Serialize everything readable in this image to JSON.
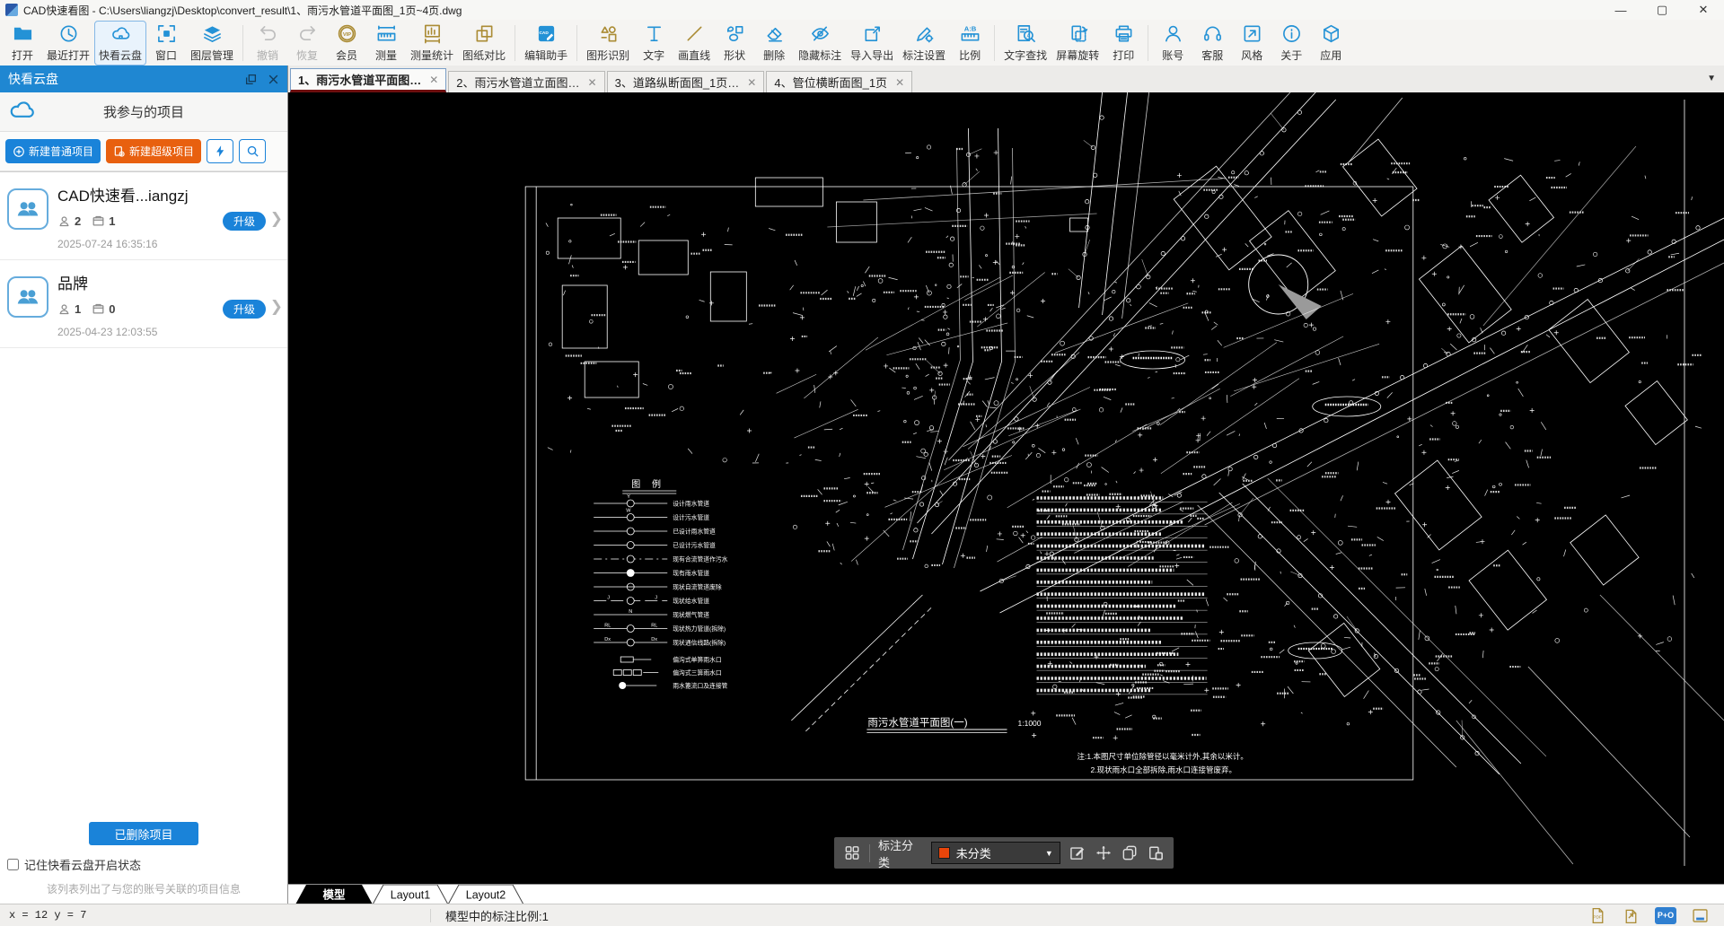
{
  "window": {
    "title": "CAD快速看图 - C:\\Users\\liangzj\\Desktop\\convert_result\\1、雨污水管道平面图_1页~4页.dwg",
    "minimize": "—",
    "maximize": "▢",
    "close": "✕"
  },
  "toolbar": {
    "items": [
      {
        "label": "打开",
        "icon": "open-folder",
        "color": "blue"
      },
      {
        "label": "最近打开",
        "icon": "recent-clock",
        "color": "blue"
      },
      {
        "label": "快看云盘",
        "icon": "cloud",
        "color": "blue",
        "state": "active"
      },
      {
        "label": "窗口",
        "icon": "window",
        "color": "blue"
      },
      {
        "label": "图层管理",
        "icon": "layers",
        "color": "blue",
        "divider_after": true
      },
      {
        "label": "撤销",
        "icon": "undo",
        "color": "gray",
        "state": "disabled"
      },
      {
        "label": "恢复",
        "icon": "redo",
        "color": "gray",
        "state": "disabled"
      },
      {
        "label": "会员",
        "icon": "vip",
        "color": "gold"
      },
      {
        "label": "测量",
        "icon": "measure",
        "color": "blue"
      },
      {
        "label": "测量统计",
        "icon": "measure-stats",
        "color": "gold"
      },
      {
        "label": "图纸对比",
        "icon": "compare",
        "color": "gold",
        "divider_after": true
      },
      {
        "label": "编辑助手",
        "icon": "edit-assistant",
        "color": "blue",
        "divider_after": true
      },
      {
        "label": "图形识别",
        "icon": "shape-recognition",
        "color": "gold"
      },
      {
        "label": "文字",
        "icon": "text",
        "color": "blue"
      },
      {
        "label": "画直线",
        "icon": "draw-line",
        "color": "gold"
      },
      {
        "label": "形状",
        "icon": "shapes",
        "color": "blue"
      },
      {
        "label": "删除",
        "icon": "eraser",
        "color": "blue"
      },
      {
        "label": "隐藏标注",
        "icon": "hide-annotation",
        "color": "blue"
      },
      {
        "label": "导入导出",
        "icon": "import-export",
        "color": "blue"
      },
      {
        "label": "标注设置",
        "icon": "annotation-settings",
        "color": "blue"
      },
      {
        "label": "比例",
        "icon": "scale-ratio",
        "color": "blue",
        "divider_after": true
      },
      {
        "label": "文字查找",
        "icon": "text-search",
        "color": "blue"
      },
      {
        "label": "屏幕旋转",
        "icon": "screen-rotate",
        "color": "blue"
      },
      {
        "label": "打印",
        "icon": "print",
        "color": "blue",
        "divider_after": true
      },
      {
        "label": "账号",
        "icon": "account",
        "color": "blue"
      },
      {
        "label": "客服",
        "icon": "support",
        "color": "blue"
      },
      {
        "label": "风格",
        "icon": "style",
        "color": "blue"
      },
      {
        "label": "关于",
        "icon": "about",
        "color": "blue"
      },
      {
        "label": "应用",
        "icon": "apps",
        "color": "blue"
      }
    ]
  },
  "sidebar": {
    "header": "快看云盘",
    "panel_title": "我参与的项目",
    "actions": {
      "new_normal": "新建普通项目",
      "new_super": "新建超级项目"
    },
    "projects": [
      {
        "name": "CAD快速看...iangzj",
        "members": "2",
        "files": "1",
        "upgrade": "升级",
        "date": "2025-07-24 16:35:16"
      },
      {
        "name": "品牌",
        "members": "1",
        "files": "0",
        "upgrade": "升级",
        "date": "2025-04-23 12:03:55"
      }
    ],
    "deleted_button": "已删除项目",
    "remember_checkbox": "记住快看云盘开启状态",
    "hint": "该列表列出了与您的账号关联的项目信息"
  },
  "doc_tabs": [
    {
      "label": "1、雨污水管道平面图…",
      "active": true
    },
    {
      "label": "2、雨污水管道立面图…",
      "active": false
    },
    {
      "label": "3、道路纵断面图_1页…",
      "active": false
    },
    {
      "label": "4、管位横断面图_1页",
      "active": false
    }
  ],
  "drawing": {
    "legend_title": "图 例",
    "legend_items": [
      {
        "label": "设计雨水管道",
        "sym": "circle-Y"
      },
      {
        "label": "设计污水管道",
        "sym": "circle-W"
      },
      {
        "label": "已设计雨水管道",
        "sym": "circle"
      },
      {
        "label": "已设计污水管道",
        "sym": "circle"
      },
      {
        "label": "现有合流管道作污水",
        "sym": "dashdot-circle"
      },
      {
        "label": "现有雨水管道",
        "sym": "dot"
      },
      {
        "label": "现状自流管道废除",
        "sym": "circle-cross"
      },
      {
        "label": "现状给水管道",
        "sym": "circle-J"
      },
      {
        "label": "现状燃气管道",
        "sym": "tick"
      },
      {
        "label": "现状热力管道(拆除)",
        "sym": "circle-RL"
      },
      {
        "label": "现状通信线路(拆除)",
        "sym": "circle-DX"
      },
      {
        "label": "偏沟式单箅雨水口",
        "sym": "inlet1"
      },
      {
        "label": "偏沟式三箅雨水口",
        "sym": "inlet3"
      },
      {
        "label": "雨水篦流口及连接管",
        "sym": "inlet-dot"
      }
    ],
    "title": "雨污水管道平面图(一)",
    "scale": "1:1000",
    "notes": [
      "注:1.本图尺寸单位除管径以毫米计外,其余以米计。",
      "2.现状雨水口全部拆除,雨水口连接管废弃。"
    ]
  },
  "annotation_bar": {
    "label": "标注分类",
    "selected": "未分类",
    "swatch_color": "#e8450a"
  },
  "layout_tabs": [
    {
      "label": "模型",
      "active": true
    },
    {
      "label": "Layout1",
      "active": false
    },
    {
      "label": "Layout2",
      "active": false
    }
  ],
  "statusbar": {
    "coords": "x = 12 y = 7",
    "scale_text": "模型中的标注比例:1"
  }
}
